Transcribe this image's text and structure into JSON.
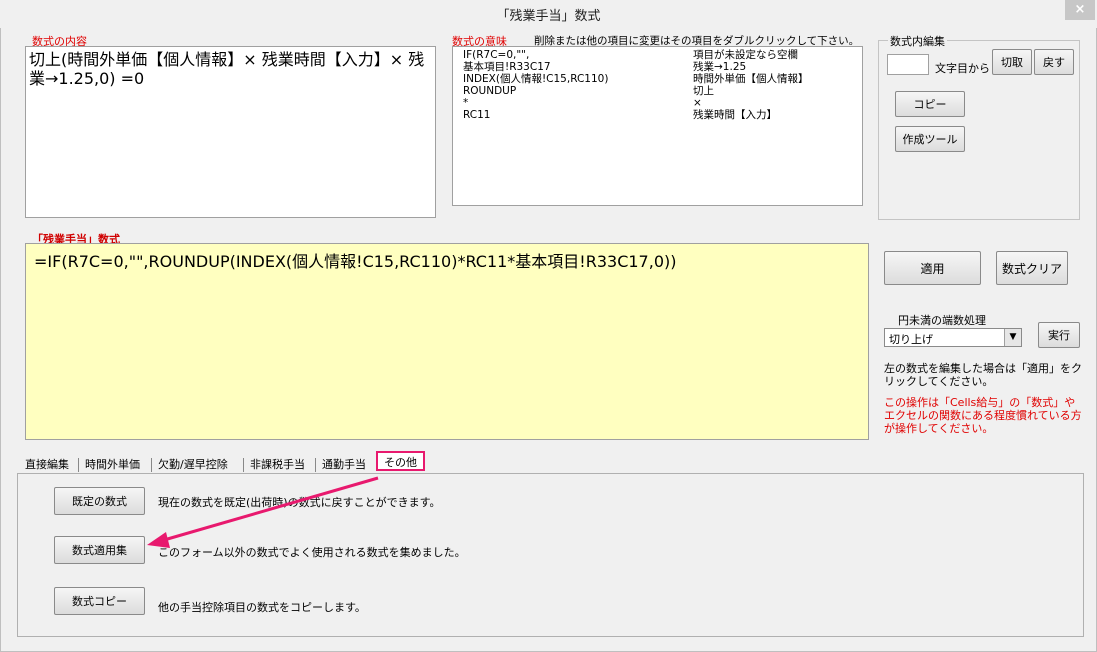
{
  "window": {
    "title": "「残業手当」数式",
    "close_label": "×"
  },
  "formula_content": {
    "label": "数式の内容",
    "text": "切上(時間外単価【個人情報】× 残業時間【入力】× 残業→1.25,0) =0"
  },
  "formula_meaning": {
    "label": "数式の意味",
    "hint": "削除または他の項目に変更はその項目をダブルクリックして下さい。",
    "rows": [
      {
        "code": "IF(R7C=0,\"\",",
        "desc": "項目が未設定なら空欄"
      },
      {
        "code": "基本項目!R33C17",
        "desc": "残業→1.25"
      },
      {
        "code": "INDEX(個人情報!C15,RC110)",
        "desc": "時間外単価【個人情報】"
      },
      {
        "code": "ROUNDUP",
        "desc": "切上"
      },
      {
        "code": "*",
        "desc": "×"
      },
      {
        "code": "RC11",
        "desc": "残業時間【入力】"
      }
    ]
  },
  "inline_edit": {
    "label": "数式内編集",
    "char_value": "",
    "char_suffix": "文字目から",
    "cut_label": "切取",
    "back_label": "戻す",
    "copy_label": "コピー",
    "tool_label": "作成ツール"
  },
  "formula": {
    "label": "「残業手当」数式",
    "text": "=IF(R7C=0,\"\",ROUNDUP(INDEX(個人情報!C15,RC110)*RC11*基本項目!R33C17,0))"
  },
  "actions": {
    "apply_label": "適用",
    "clear_label": "数式クリア"
  },
  "rounding": {
    "label": "円未満の端数処理",
    "selected": "切り上げ",
    "run_label": "実行",
    "note": "左の数式を編集した場合は「適用」をクリックしてください。",
    "warning": "この操作は「Cells給与」の「数式」やエクセルの関数にある程度慣れている方が操作してください。"
  },
  "tabs": [
    "直接編集",
    "時間外単価",
    "欠勤/遅早控除",
    "非課税手当",
    "通勤手当",
    "その他"
  ],
  "other_panel": {
    "items": [
      {
        "button": "既定の数式",
        "desc": "現在の数式を既定(出荷時)の数式に戻すことができます。"
      },
      {
        "button": "数式適用集",
        "desc": "このフォーム以外の数式でよく使用される数式を集めました。"
      },
      {
        "button": "数式コピー",
        "desc": "他の手当控除項目の数式をコピーします。"
      }
    ]
  },
  "colors": {
    "highlight": "#e8196e",
    "formula_bg": "#ffffc0",
    "label_red": "#e00000"
  }
}
